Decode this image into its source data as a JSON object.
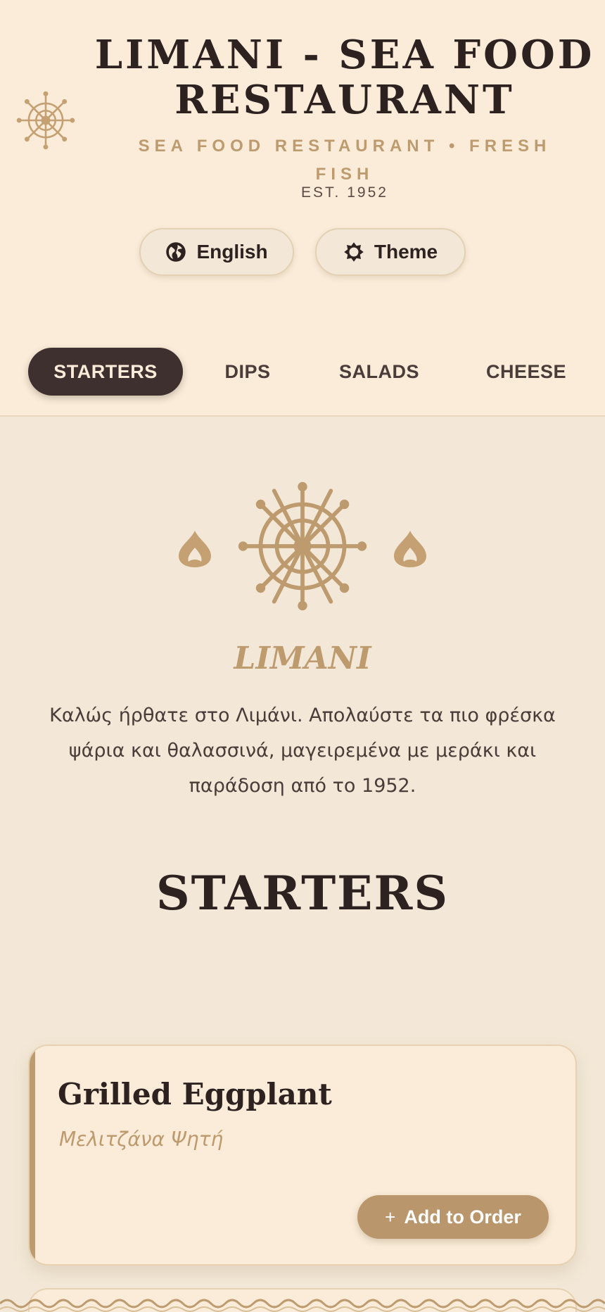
{
  "header": {
    "title": "LIMANI - SEA FOOD RESTAURANT",
    "subtitle": "SEA FOOD RESTAURANT • FRESH FISH",
    "established": "EST. 1952",
    "language_button": {
      "label": "English",
      "icon": "globe-icon"
    },
    "theme_button": {
      "label": "Theme",
      "icon": "sun-icon"
    }
  },
  "tabs": [
    {
      "label": "STARTERS",
      "active": true
    },
    {
      "label": "DIPS",
      "active": false
    },
    {
      "label": "SALADS",
      "active": false
    },
    {
      "label": "CHEESE",
      "active": false
    }
  ],
  "hero": {
    "title": "LIMANI",
    "text": "Καλώς ήρθατε στο Λιμάνι. Απολαύστε τα πιο φρέσκα ψάρια και θαλασσινά, μαγειρεμένα με μεράκι και παράδοση από το 1952."
  },
  "section": {
    "title": "STARTERS"
  },
  "items": [
    {
      "name": "Grilled Eggplant",
      "greek_name": "Μελιτζάνα Ψητή",
      "button_label": "Add to Order",
      "button_icon": "+"
    }
  ],
  "colors": {
    "background": "#f3e8d7",
    "header_bg": "#faecd9",
    "accent": "#bd9b6f",
    "dark": "#3e302f",
    "text": "#2e2220"
  }
}
